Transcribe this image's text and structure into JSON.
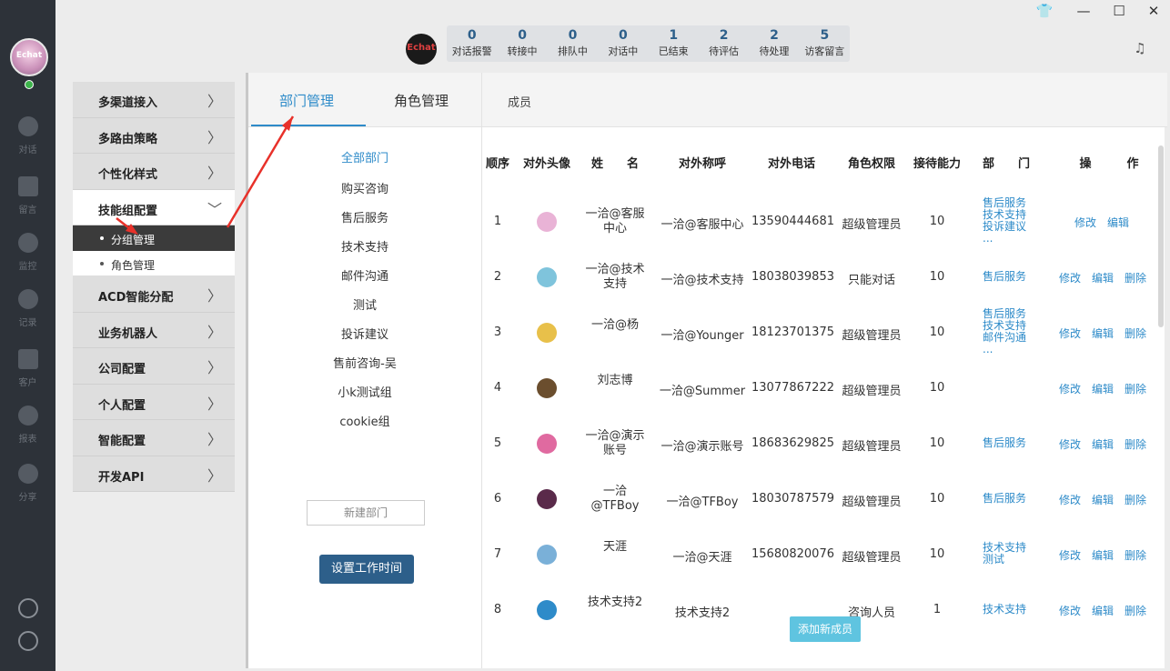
{
  "window": {
    "controls": {
      "skin": "👕",
      "minimize": "—",
      "maximize": "☐",
      "close": "✕"
    }
  },
  "rail": {
    "avatar_label": "Echat",
    "items": [
      {
        "label": "对话",
        "icon": "chat-icon"
      },
      {
        "label": "留言",
        "icon": "mail-icon"
      },
      {
        "label": "监控",
        "icon": "eye-icon"
      },
      {
        "label": "记录",
        "icon": "clock-icon"
      },
      {
        "label": "客户",
        "icon": "contact-card-icon"
      },
      {
        "label": "报表",
        "icon": "pie-chart-icon"
      },
      {
        "label": "分享",
        "icon": "share-icon"
      }
    ]
  },
  "topbar": {
    "logo": "Echat",
    "stats": [
      {
        "num": "0",
        "label": "对话报警"
      },
      {
        "num": "0",
        "label": "转接中"
      },
      {
        "num": "0",
        "label": "排队中"
      },
      {
        "num": "0",
        "label": "对话中"
      },
      {
        "num": "1",
        "label": "已结束"
      },
      {
        "num": "2",
        "label": "待评估"
      },
      {
        "num": "2",
        "label": "待处理"
      },
      {
        "num": "5",
        "label": "访客留言"
      }
    ]
  },
  "menu": {
    "items": [
      {
        "label": "多渠道接入"
      },
      {
        "label": "多路由策略"
      },
      {
        "label": "个性化样式"
      },
      {
        "label": "技能组配置"
      },
      {
        "label": "ACD智能分配"
      },
      {
        "label": "业务机器人"
      },
      {
        "label": "公司配置"
      },
      {
        "label": "个人配置"
      },
      {
        "label": "智能配置"
      },
      {
        "label": "开发API"
      }
    ],
    "sub": [
      {
        "label": "分组管理"
      },
      {
        "label": "角色管理"
      }
    ],
    "chev_right": "〉",
    "chev_down": "﹀"
  },
  "tabs": {
    "dept_mgmt": "部门管理",
    "role_mgmt": "角色管理",
    "members": "成员"
  },
  "depts": [
    "全部部门",
    "购买咨询",
    "售后服务",
    "技术支持",
    "邮件沟通",
    "测试",
    "投诉建议",
    "售前咨询-吴",
    "小k测试组",
    "cookie组"
  ],
  "buttons": {
    "new_dept": "新建部门",
    "work_time": "设置工作时间",
    "add_member": "添加新成员"
  },
  "table": {
    "headers": {
      "order": "顺序",
      "avatar": "对外头像",
      "name": "姓　　名",
      "nickname": "对外称呼",
      "phone": "对外电话",
      "role": "角色权限",
      "capacity": "接待能力",
      "dept": "部　　门",
      "ops": "操　　　作"
    },
    "rows": [
      {
        "order": "1",
        "name": "一洽@客服中心",
        "nickname": "一洽@客服中心",
        "phone": "13590444681",
        "role": "超级管理员",
        "capacity": "10",
        "depts": [
          "售后服务",
          "技术支持",
          "投诉建议",
          "..."
        ],
        "ops": [
          "修改",
          "编辑"
        ],
        "avatar_color": "#e9b3d6"
      },
      {
        "order": "2",
        "name": "一洽@技术支持",
        "nickname": "一洽@技术支持",
        "phone": "18038039853",
        "role": "只能对话",
        "capacity": "10",
        "depts": [
          "售后服务"
        ],
        "ops": [
          "修改",
          "编辑",
          "删除"
        ],
        "avatar_color": "#7fc4dc"
      },
      {
        "order": "3",
        "name": "一洽@杨",
        "nickname": "一洽@Younger",
        "phone": "18123701375",
        "role": "超级管理员",
        "capacity": "10",
        "depts": [
          "售后服务",
          "技术支持",
          "邮件沟通",
          "..."
        ],
        "ops": [
          "修改",
          "编辑",
          "删除"
        ],
        "avatar_color": "#e8c04a"
      },
      {
        "order": "4",
        "name": "刘志博",
        "nickname": "一洽@Summer",
        "phone": "13077867222",
        "role": "超级管理员",
        "capacity": "10",
        "depts": [],
        "ops": [
          "修改",
          "编辑",
          "删除"
        ],
        "avatar_color": "#6b4e2e"
      },
      {
        "order": "5",
        "name": "一洽@演示账号",
        "nickname": "一洽@演示账号",
        "phone": "18683629825",
        "role": "超级管理员",
        "capacity": "10",
        "depts": [
          "售后服务"
        ],
        "ops": [
          "修改",
          "编辑",
          "删除"
        ],
        "avatar_color": "#e06aa0"
      },
      {
        "order": "6",
        "name": "一洽@TFBoy",
        "nickname": "一洽@TFBoy",
        "phone": "18030787579",
        "role": "超级管理员",
        "capacity": "10",
        "depts": [
          "售后服务"
        ],
        "ops": [
          "修改",
          "编辑",
          "删除"
        ],
        "avatar_color": "#5a2a4a"
      },
      {
        "order": "7",
        "name": "天涯",
        "nickname": "一洽@天涯",
        "phone": "15680820076",
        "role": "超级管理员",
        "capacity": "10",
        "depts": [
          "技术支持",
          "测试"
        ],
        "ops": [
          "修改",
          "编辑",
          "删除"
        ],
        "avatar_color": "#7ab0d8"
      },
      {
        "order": "8",
        "name": "技术支持2",
        "nickname": "技术支持2",
        "phone": "",
        "role": "咨询人员",
        "capacity": "1",
        "depts": [
          "技术支持"
        ],
        "ops": [
          "修改",
          "编辑",
          "删除"
        ],
        "avatar_color": "#2e8bc9"
      }
    ]
  },
  "colors": {
    "accent": "#2e8bc9",
    "rail": "#2d3239",
    "primary_button": "#2d5f8a",
    "add_button": "#5fc4e0",
    "annotation": "#e8312a"
  }
}
